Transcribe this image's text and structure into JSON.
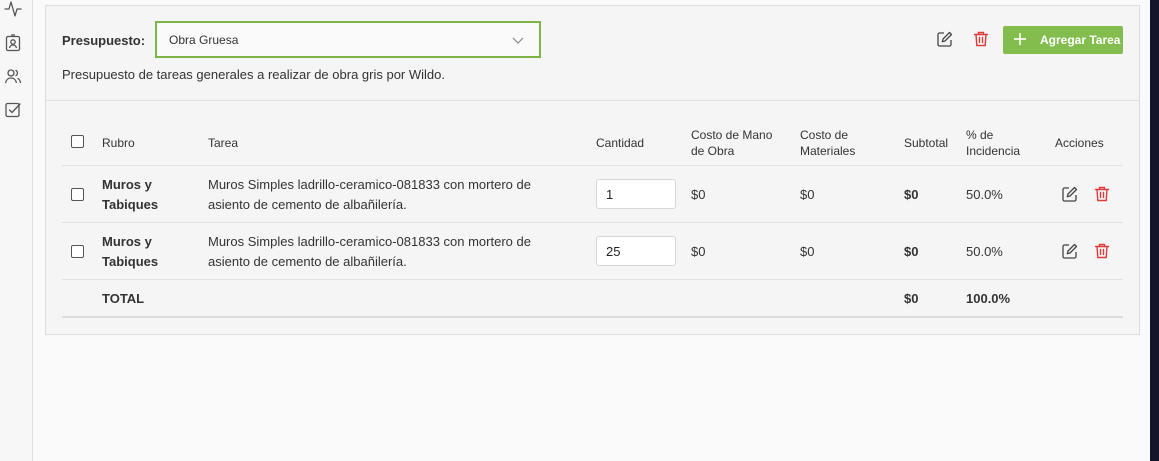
{
  "sidebar": {
    "icons": [
      "activity-icon",
      "contact-card-icon",
      "users-icon",
      "checkbox-icon"
    ]
  },
  "header": {
    "budget_label": "Presupuesto:",
    "budget_select": {
      "value": "Obra Gruesa"
    },
    "description": "Presupuesto de tareas generales a realizar de obra gris por Wildo.",
    "add_button_label": "Agregar Tarea"
  },
  "table": {
    "columns": {
      "rubro": "Rubro",
      "tarea": "Tarea",
      "cantidad": "Cantidad",
      "costo_mano_obra_line1": "Costo de Mano",
      "costo_mano_obra_line2": "de Obra",
      "costo_materiales_line1": "Costo de",
      "costo_materiales_line2": "Materiales",
      "subtotal": "Subtotal",
      "incidencia_line1": "% de",
      "incidencia_line2": "Incidencia",
      "acciones": "Acciones"
    },
    "rows": [
      {
        "rubro_line1": "Muros y",
        "rubro_line2": "Tabiques",
        "tarea_line1": "Muros Simples ladrillo-ceramico-081833 con mortero de",
        "tarea_line2": "asiento de cemento de albañilería.",
        "cantidad": "1",
        "costo_mano_obra": "$0",
        "costo_materiales": "$0",
        "subtotal": "$0",
        "incidencia": "50.0%"
      },
      {
        "rubro_line1": "Muros y",
        "rubro_line2": "Tabiques",
        "tarea_line1": "Muros Simples ladrillo-ceramico-081833 con mortero de",
        "tarea_line2": "asiento de cemento de albañilería.",
        "cantidad": "25",
        "costo_mano_obra": "$0",
        "costo_materiales": "$0",
        "subtotal": "$0",
        "incidencia": "50.0%"
      }
    ],
    "total": {
      "label": "TOTAL",
      "subtotal": "$0",
      "incidencia": "100.0%"
    }
  },
  "colors": {
    "accent_green": "#82bd4e",
    "select_border": "#7db54a",
    "delete_red": "#e03b3b"
  }
}
